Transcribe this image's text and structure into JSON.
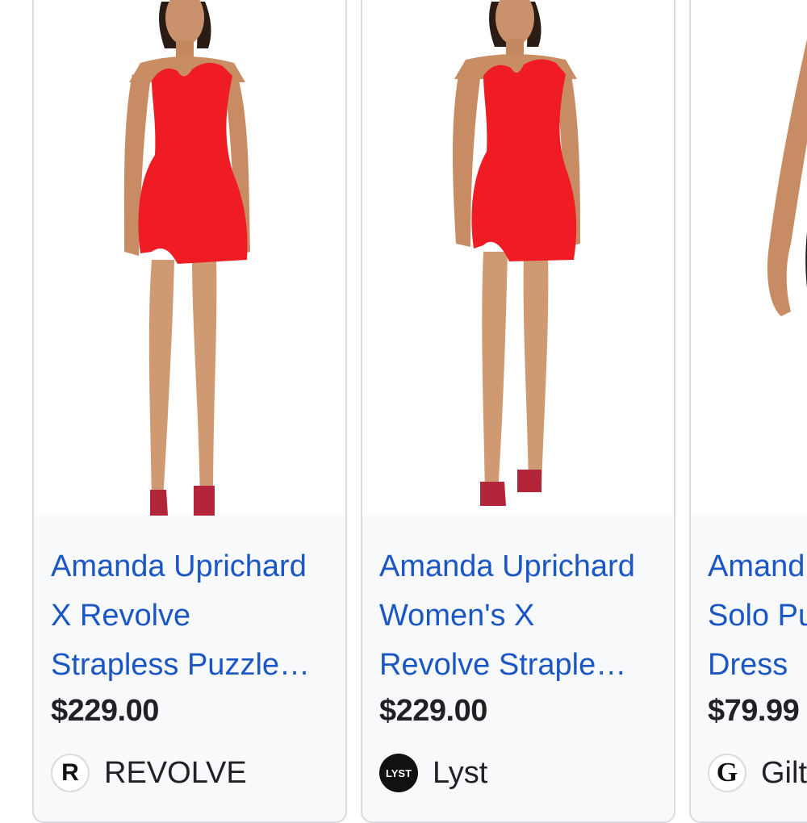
{
  "products": [
    {
      "title_lines": [
        "Amanda Uprichard",
        "X Revolve",
        "Strapless Puzzle…"
      ],
      "price": "$229.00",
      "store": "REVOLVE",
      "store_icon": "revolve-logo-icon",
      "store_logo_text": "R",
      "dress_color": "#ef1c24"
    },
    {
      "title_lines": [
        "Amanda Uprichard",
        "Women's X",
        "Revolve Straple…"
      ],
      "price": "$229.00",
      "store": "Lyst",
      "store_icon": "lyst-logo-icon",
      "store_logo_text": "LYST",
      "dress_color": "#ef1c24"
    },
    {
      "title_lines": [
        "Amand",
        "Solo Pu",
        "Dress"
      ],
      "price": "$79.99",
      "store": "Gilt",
      "store_icon": "gilt-logo-icon",
      "store_logo_text": "G",
      "dress_color": "#1c1f1c"
    }
  ],
  "colors": {
    "link_blue": "#1a56c4",
    "text_dark": "#202124",
    "card_border": "#dadce0",
    "card_bg": "#f8f9fa"
  }
}
